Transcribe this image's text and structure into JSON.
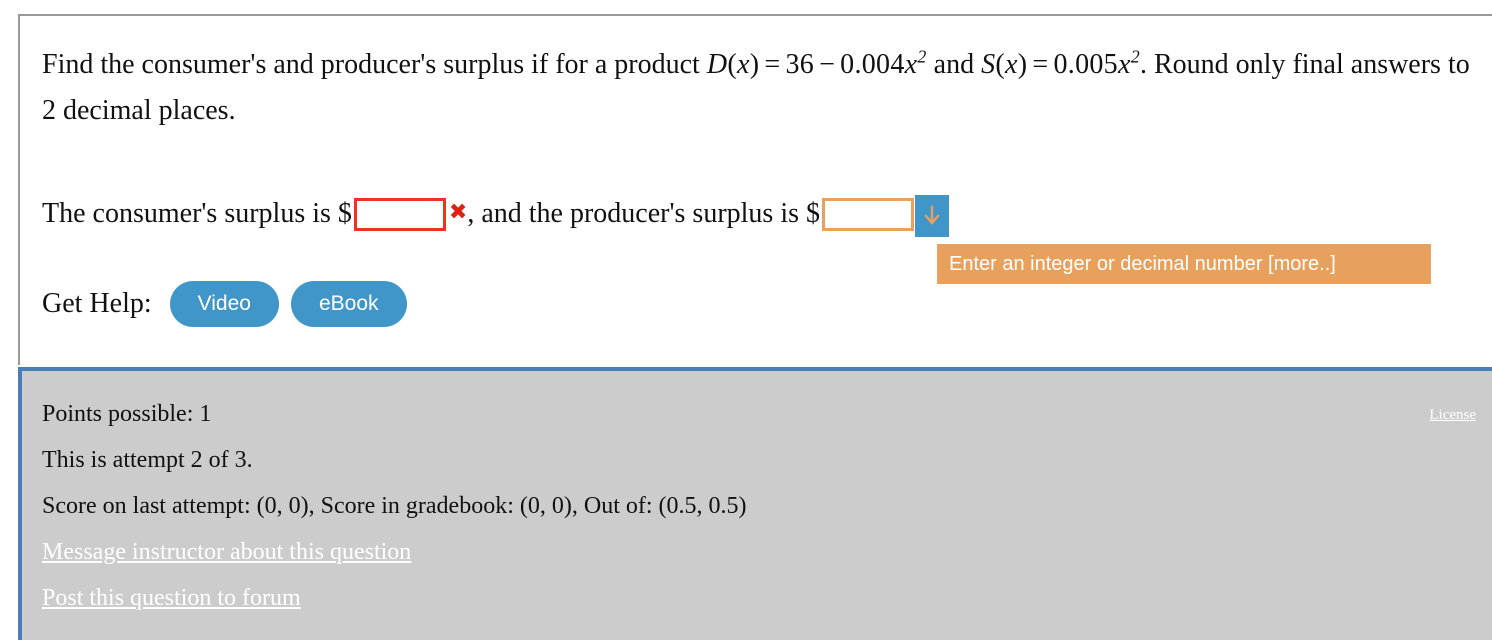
{
  "question": {
    "prompt_part1": "Find the consumer's and producer's surplus if for a product ",
    "demand_fn": "D(x) = 36 − 0.004x²",
    "prompt_mid": " and ",
    "supply_fn": "S(x) = 0.005x²",
    "prompt_part2": " . Round only final answers to 2 decimal places.",
    "math": {
      "D_name": "D",
      "D_arg": "x",
      "D_eq": "=",
      "D_const": "36",
      "D_minus": "−",
      "D_coef": "0.004",
      "D_var": "x",
      "D_exp": "2",
      "S_name": "S",
      "S_arg": "x",
      "S_eq": "=",
      "S_coef": "0.005",
      "S_var": "x",
      "S_exp": "2",
      "and_word": "and",
      "tail": ". Round",
      "line2": "only final answers to 2 decimal places."
    }
  },
  "answer_line": {
    "text_before": "The consumer's surplus is $",
    "consumer_value": "",
    "consumer_placeholder": "",
    "error_mark": "✖",
    "text_middle": ", and the producer's surplus is $",
    "producer_value": "",
    "producer_placeholder": "",
    "arrow_icon": "down-arrow-icon",
    "tooltip": "Enter an integer or decimal number [more..]"
  },
  "help": {
    "label": "Get Help:",
    "buttons": [
      {
        "label": "Video",
        "name": "video-help-button"
      },
      {
        "label": "eBook",
        "name": "ebook-help-button"
      }
    ]
  },
  "footer": {
    "points_possible": "Points possible: 1",
    "attempt": "This is attempt 2 of 3.",
    "scores": "Score on last attempt: (0, 0), Score in gradebook: (0, 0), Out of: (0.5, 0.5)",
    "message_instructor": "Message instructor about this question",
    "post_forum": "Post this question to forum",
    "license": "License"
  },
  "colors": {
    "accent_blue": "#4096c8",
    "footer_border_blue": "#4a7ebb",
    "tooltip_orange": "#e8a15c",
    "error_red": "#ee3322",
    "footer_gray": "#cccccc"
  }
}
